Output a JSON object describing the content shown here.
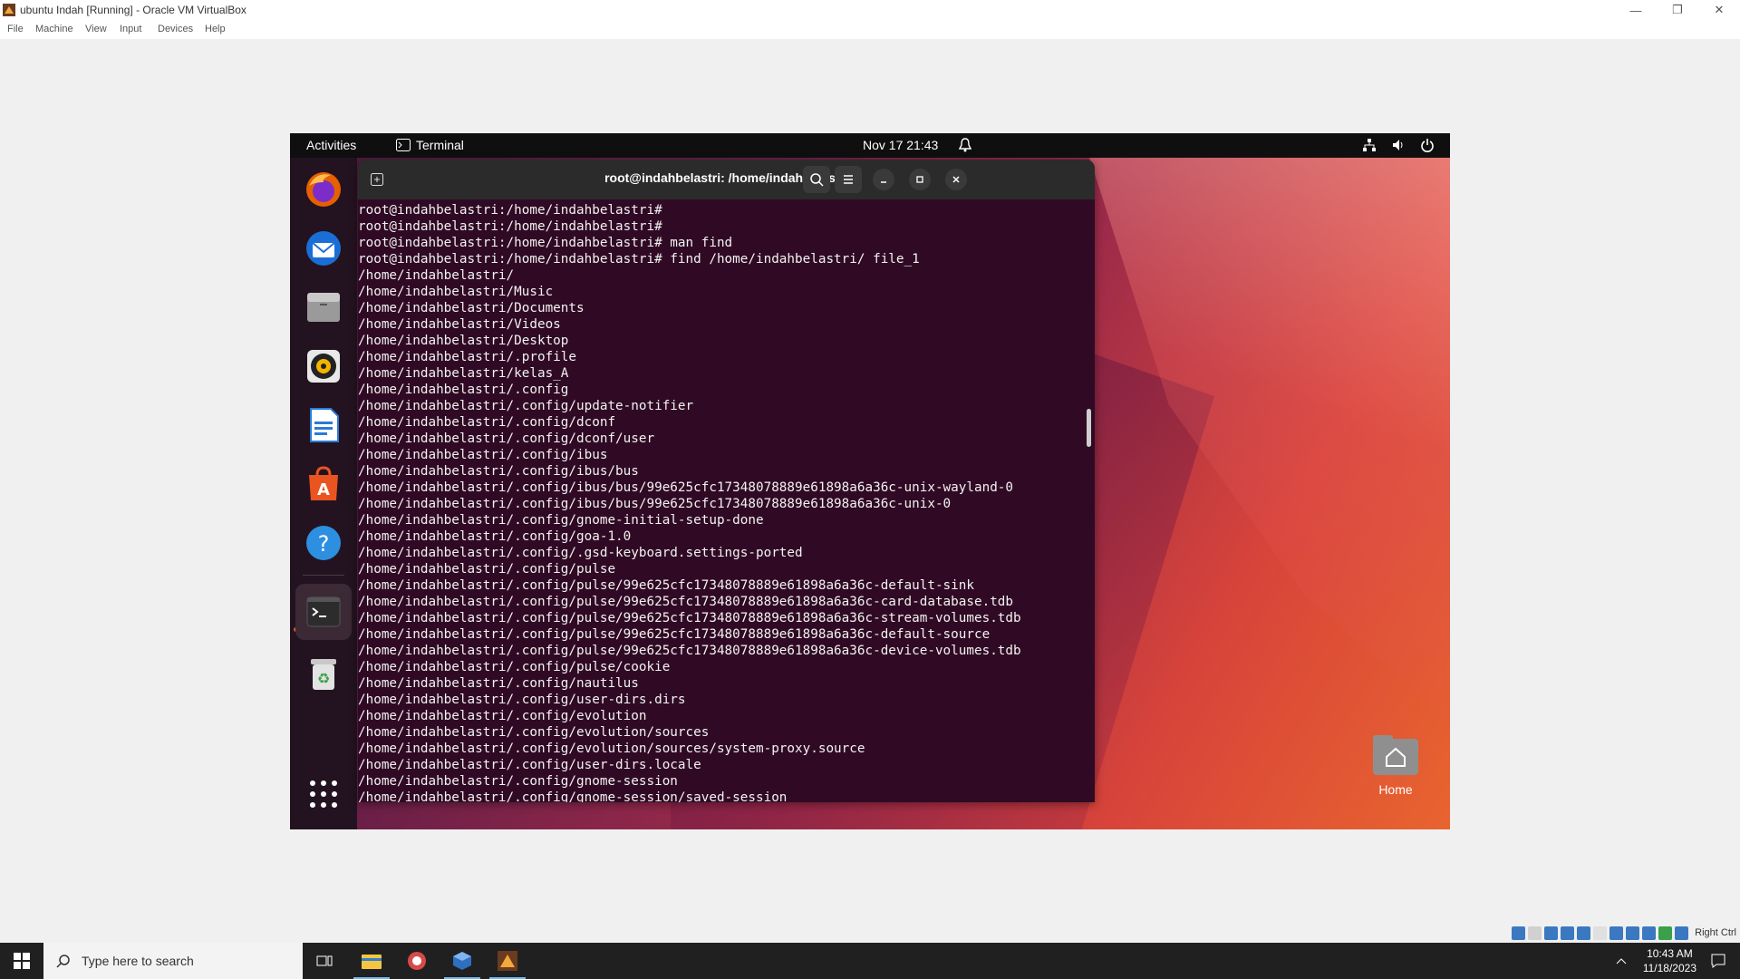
{
  "host_window": {
    "title": "ubuntu Indah [Running] - Oracle VM VirtualBox",
    "menu": [
      "File",
      "Machine",
      "View",
      "Input",
      "Devices",
      "Help"
    ]
  },
  "topbar": {
    "activities": "Activities",
    "app_name": "Terminal",
    "clock": "Nov 17  21:43"
  },
  "dock": {
    "apps": [
      "firefox-icon",
      "thunderbird-icon",
      "files-icon",
      "rhythmbox-icon",
      "writer-icon",
      "app-center-icon",
      "help-icon",
      "terminal-icon",
      "trash-icon",
      "show-apps-icon"
    ]
  },
  "terminal": {
    "title": "root@indahbelastri: /home/indahbelastri",
    "lines": [
      "root@indahbelastri:/home/indahbelastri#",
      "root@indahbelastri:/home/indahbelastri#",
      "root@indahbelastri:/home/indahbelastri# man find",
      "root@indahbelastri:/home/indahbelastri# find /home/indahbelastri/ file_1",
      "/home/indahbelastri/",
      "/home/indahbelastri/Music",
      "/home/indahbelastri/Documents",
      "/home/indahbelastri/Videos",
      "/home/indahbelastri/Desktop",
      "/home/indahbelastri/.profile",
      "/home/indahbelastri/kelas_A",
      "/home/indahbelastri/.config",
      "/home/indahbelastri/.config/update-notifier",
      "/home/indahbelastri/.config/dconf",
      "/home/indahbelastri/.config/dconf/user",
      "/home/indahbelastri/.config/ibus",
      "/home/indahbelastri/.config/ibus/bus",
      "/home/indahbelastri/.config/ibus/bus/99e625cfc17348078889e61898a6a36c-unix-wayland-0",
      "/home/indahbelastri/.config/ibus/bus/99e625cfc17348078889e61898a6a36c-unix-0",
      "/home/indahbelastri/.config/gnome-initial-setup-done",
      "/home/indahbelastri/.config/goa-1.0",
      "/home/indahbelastri/.config/.gsd-keyboard.settings-ported",
      "/home/indahbelastri/.config/pulse",
      "/home/indahbelastri/.config/pulse/99e625cfc17348078889e61898a6a36c-default-sink",
      "/home/indahbelastri/.config/pulse/99e625cfc17348078889e61898a6a36c-card-database.tdb",
      "/home/indahbelastri/.config/pulse/99e625cfc17348078889e61898a6a36c-stream-volumes.tdb",
      "/home/indahbelastri/.config/pulse/99e625cfc17348078889e61898a6a36c-default-source",
      "/home/indahbelastri/.config/pulse/99e625cfc17348078889e61898a6a36c-device-volumes.tdb",
      "/home/indahbelastri/.config/pulse/cookie",
      "/home/indahbelastri/.config/nautilus",
      "/home/indahbelastri/.config/user-dirs.dirs",
      "/home/indahbelastri/.config/evolution",
      "/home/indahbelastri/.config/evolution/sources",
      "/home/indahbelastri/.config/evolution/sources/system-proxy.source",
      "/home/indahbelastri/.config/user-dirs.locale",
      "/home/indahbelastri/.config/gnome-session",
      "/home/indahbelastri/.config/gnome-session/saved-session"
    ]
  },
  "desktop": {
    "home_label": "Home"
  },
  "vb_status": {
    "right_ctrl": "Right Ctrl"
  },
  "taskbar": {
    "search_placeholder": "Type here to search",
    "time": "10:43 AM",
    "date": "11/18/2023"
  },
  "colors": {
    "terminal_bg": "#300a24",
    "ubuntu_orange": "#e95420",
    "topbar_bg": "#0f0f0f"
  }
}
